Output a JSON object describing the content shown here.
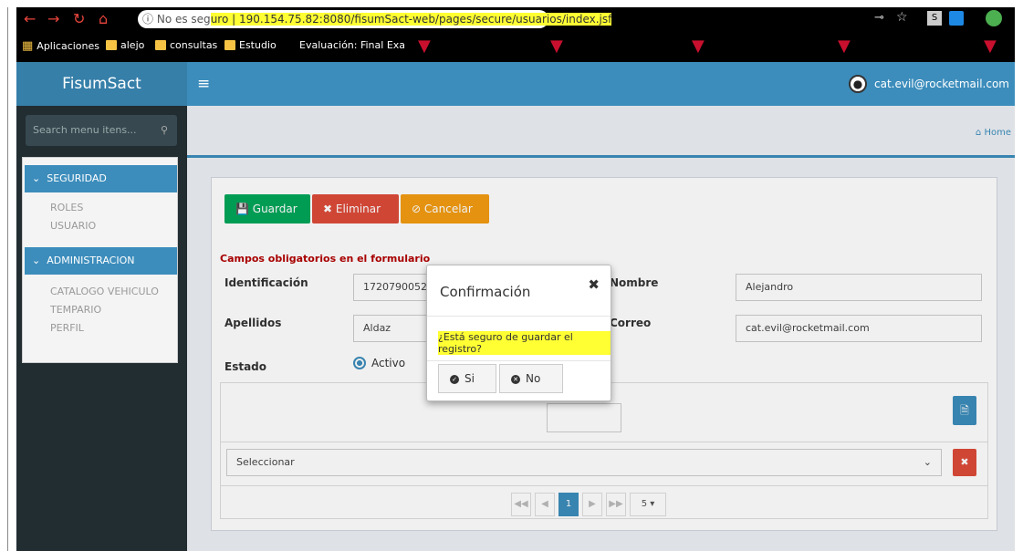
{
  "browser": {
    "security_warning": "No es seg",
    "url_highlight_start": "uro",
    "url_host": "190.154.75.82",
    "url_rest": ":8080/fisumSact-web/pages/secure/usuarios/index.jsf",
    "bookmarks": [
      {
        "label": "Aplicaciones"
      },
      {
        "label": "alejo"
      },
      {
        "label": "consultas"
      },
      {
        "label": "Estudio"
      },
      {
        "label": "Evaluación: Final Exa"
      }
    ]
  },
  "header": {
    "brand": "FisumSact",
    "user_email": "cat.evil@rocketmail.com"
  },
  "sidebar": {
    "search_placeholder": "Search menu itens...",
    "sections": [
      {
        "label": "SEGURIDAD",
        "items": [
          "ROLES",
          "USUARIO"
        ]
      },
      {
        "label": "ADMINISTRACION",
        "items": [
          "CATALOGO VEHICULO",
          "TEMPARIO",
          "PERFIL"
        ]
      }
    ]
  },
  "breadcrumb": {
    "home": "Home"
  },
  "toolbar": {
    "save": "Guardar",
    "delete": "Eliminar",
    "cancel": "Cancelar"
  },
  "form": {
    "required_note": "Campos obligatorios en el formulario",
    "id_label": "Identificación",
    "id_value": "1720790052",
    "name_label": "Nombre",
    "name_value": "Alejandro",
    "lastname_label": "Apellidos",
    "lastname_value": "Aldaz",
    "email_label": "Correo",
    "email_value": "cat.evil@rocketmail.com",
    "status_label": "Estado",
    "status_value": "Activo"
  },
  "table": {
    "select_placeholder": "Seleccionar",
    "current_page": "1",
    "page_size": "5"
  },
  "dialog": {
    "title": "Confirmación",
    "message": "¿Está seguro de guardar el registro?",
    "yes": "Si",
    "no": "No"
  },
  "colors": {
    "primary": "#3c8dbc",
    "success": "#00a65a",
    "danger": "#dd4b39",
    "warning": "#f39c12"
  }
}
